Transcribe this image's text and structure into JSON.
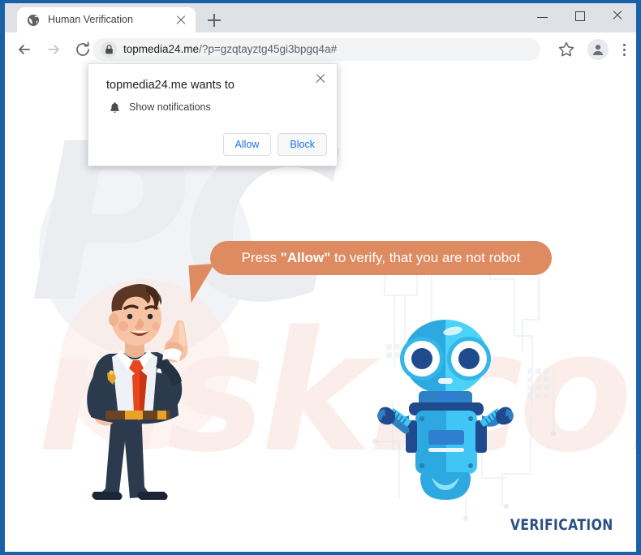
{
  "browser": {
    "tab": {
      "title": "Human Verification",
      "favicon_icon": "globe-icon",
      "close_icon": "close-icon"
    },
    "new_tab_icon": "plus-icon",
    "window_controls": {
      "minimize_icon": "minimize-icon",
      "maximize_icon": "maximize-icon",
      "close_icon": "close-icon"
    },
    "toolbar": {
      "back_icon": "arrow-left-icon",
      "forward_icon": "arrow-right-icon",
      "reload_icon": "reload-icon",
      "lock_icon": "lock-icon",
      "url_domain": "topmedia24.me",
      "url_path": "/?p=gzqtayztg45gi3bpgq4a#",
      "bookmark_icon": "star-icon",
      "profile_icon": "avatar-icon",
      "menu_icon": "kebab-menu-icon"
    }
  },
  "popup": {
    "title": "topmedia24.me wants to",
    "permission_icon": "bell-icon",
    "permission_label": "Show notifications",
    "allow_label": "Allow",
    "block_label": "Block",
    "close_icon": "close-icon"
  },
  "page": {
    "bubble": {
      "prefix": "Press ",
      "emphasis": "\"Allow\"",
      "suffix": " to verify, that you are not robot"
    },
    "man_illustration": "businessman-pointing-up-illustration",
    "robot_illustration": "blue-robot-illustration",
    "logo_text": "VERIFICATION",
    "watermark_primary": "PC",
    "watermark_secondary": "risk.com"
  },
  "colors": {
    "window_border": "#1a62a8",
    "tabstrip_bg": "#dee1e6",
    "omnibox_bg": "#f1f3f4",
    "bubble": "#df8b62",
    "link_blue": "#1a73e8",
    "logo_blue": "#2b4f85",
    "robot_body": "#3fc6f4",
    "robot_dark": "#1f4b8e",
    "suit_navy": "#2b3a4d",
    "tie_red": "#e8461e"
  }
}
